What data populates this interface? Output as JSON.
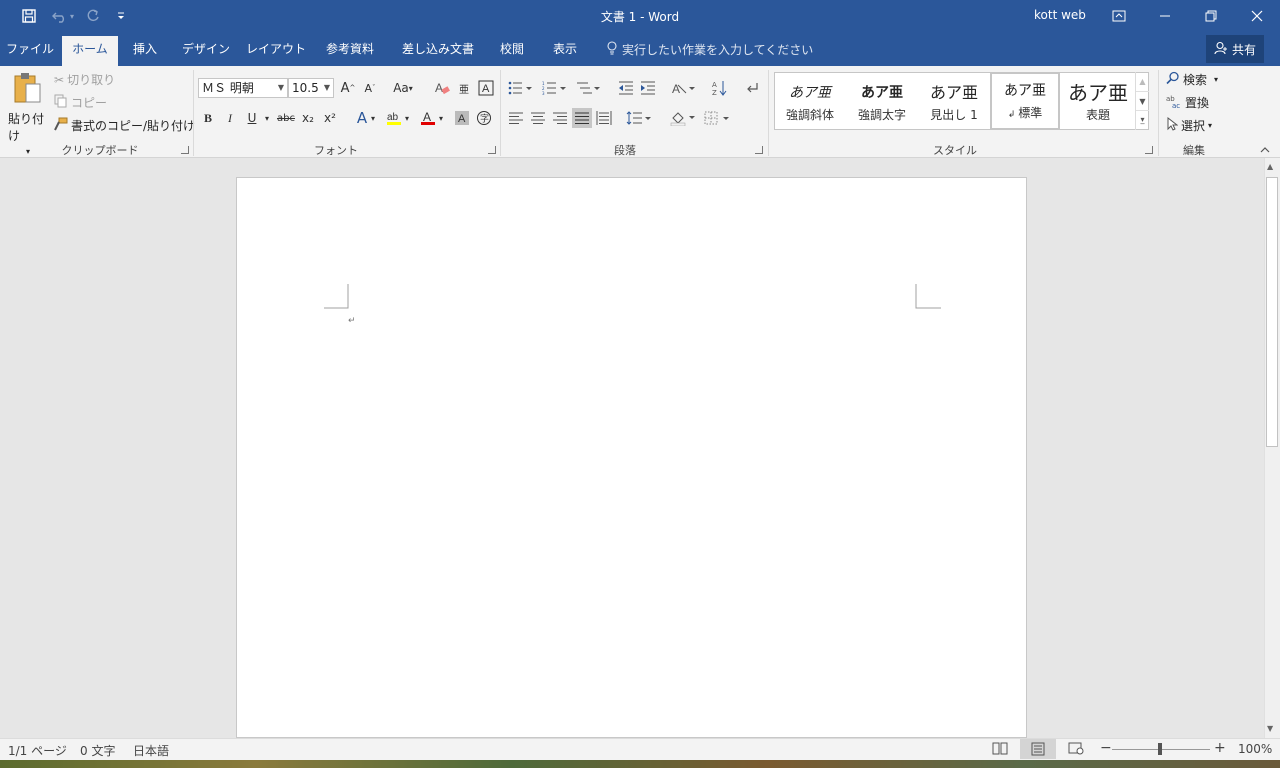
{
  "titlebar": {
    "document_title": "文書 1 - Word",
    "user": "kott web",
    "qat": {
      "save_icon": "save-icon",
      "undo_icon": "undo-icon",
      "redo_icon": "redo-icon",
      "customize_icon": "chevron-down-icon"
    }
  },
  "tabs": [
    {
      "label": "ファイル",
      "active": false
    },
    {
      "label": "ホーム",
      "active": true
    },
    {
      "label": "挿入",
      "active": false
    },
    {
      "label": "デザイン",
      "active": false
    },
    {
      "label": "レイアウト",
      "active": false
    },
    {
      "label": "参考資料",
      "active": false
    },
    {
      "label": "差し込み文書",
      "active": false
    },
    {
      "label": "校閲",
      "active": false
    },
    {
      "label": "表示",
      "active": false
    }
  ],
  "tell_me": "実行したい作業を入力してください",
  "share": "共有",
  "clipboard": {
    "paste": "貼り付け",
    "cut": "切り取り",
    "copy": "コピー",
    "format_painter": "書式のコピー/貼り付け",
    "label": "クリップボード"
  },
  "font": {
    "font_name": "ＭＳ 明朝",
    "font_size": "10.5",
    "case_label": "Aa",
    "bold": "B",
    "italic": "I",
    "underline": "U",
    "strike": "abc",
    "subscript": "x₂",
    "superscript": "x²",
    "label": "フォント"
  },
  "paragraph": {
    "label": "段落"
  },
  "styles": {
    "items": [
      {
        "sample": "あア亜",
        "name": "強調斜体"
      },
      {
        "sample": "あア亜",
        "name": "強調太字"
      },
      {
        "sample": "あア亜",
        "name": "見出し 1"
      },
      {
        "sample": "あア亜",
        "name": "標準"
      },
      {
        "sample": "あア亜",
        "name": "表題"
      }
    ],
    "selected": "標準",
    "label": "スタイル"
  },
  "editing": {
    "find": "検索",
    "replace": "置換",
    "select": "選択",
    "label": "編集"
  },
  "document": {
    "paragraph_mark": "↵"
  },
  "statusbar": {
    "page": "1/1 ページ",
    "words": "0 文字",
    "language": "日本語",
    "zoom": "100%"
  },
  "colors": {
    "accent": "#2b579a",
    "font_color": "#e00000",
    "highlight": "#ffff00"
  }
}
